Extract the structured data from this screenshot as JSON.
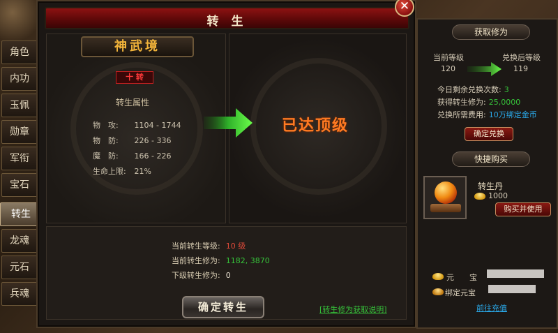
{
  "window": {
    "title": "转 生",
    "close_glyph": "✕"
  },
  "tabs": [
    {
      "label": "角色",
      "active": false
    },
    {
      "label": "内功",
      "active": false
    },
    {
      "label": "玉佩",
      "active": false
    },
    {
      "label": "勋章",
      "active": false
    },
    {
      "label": "军衔",
      "active": false
    },
    {
      "label": "宝石",
      "active": false
    },
    {
      "label": "转生",
      "active": true
    },
    {
      "label": "龙魂",
      "active": false
    },
    {
      "label": "元石",
      "active": false
    },
    {
      "label": "兵魂",
      "active": false
    }
  ],
  "realm": {
    "name": "神武境",
    "level_badge": "十 转",
    "attr_title": "转生属性",
    "attributes": [
      {
        "label": "物　攻:",
        "value": "1104 - 1744"
      },
      {
        "label": "物　防:",
        "value": "226 - 336"
      },
      {
        "label": "魔　防:",
        "value": "166 - 226"
      },
      {
        "label": "生命上限:",
        "value": "21%"
      }
    ],
    "max_text": "已达顶级"
  },
  "status": {
    "current_level_label": "当前转生等级:",
    "current_level_value": "10 级",
    "current_cultivation_label": "当前转生修为:",
    "current_cultivation_value": "1182, 3870",
    "next_cultivation_label": "下级转生修为:",
    "next_cultivation_value": "0"
  },
  "actions": {
    "confirm_label": "确定转生",
    "help_link": "[转生修为获取说明]"
  },
  "sidebar": {
    "exchange_header": "获取修为",
    "current_level_label": "当前等级",
    "current_level_value": "120",
    "after_level_label": "兑换后等级",
    "after_level_value": "119",
    "remaining_label": "今日剩余兑换次数:",
    "remaining_value": "3",
    "gain_label": "获得转生修为:",
    "gain_value": "25,0000",
    "cost_label": "兑换所需费用:",
    "cost_value": "10万绑定金币",
    "exchange_button": "确定兑换",
    "quick_header": "快捷购买",
    "item_name": "转生丹",
    "item_price": "1000",
    "buy_button": "购买并使用",
    "yuanbao_label": "元　　宝",
    "bound_yuanbao_label": "绑定元宝",
    "recharge_link": "前往充值"
  },
  "colors": {
    "title_red": "#8c1212",
    "arrow_green": "#36c23a",
    "max_orange": "#ff7a22",
    "link_green": "#36c23a",
    "link_blue": "#2aa8e8"
  }
}
